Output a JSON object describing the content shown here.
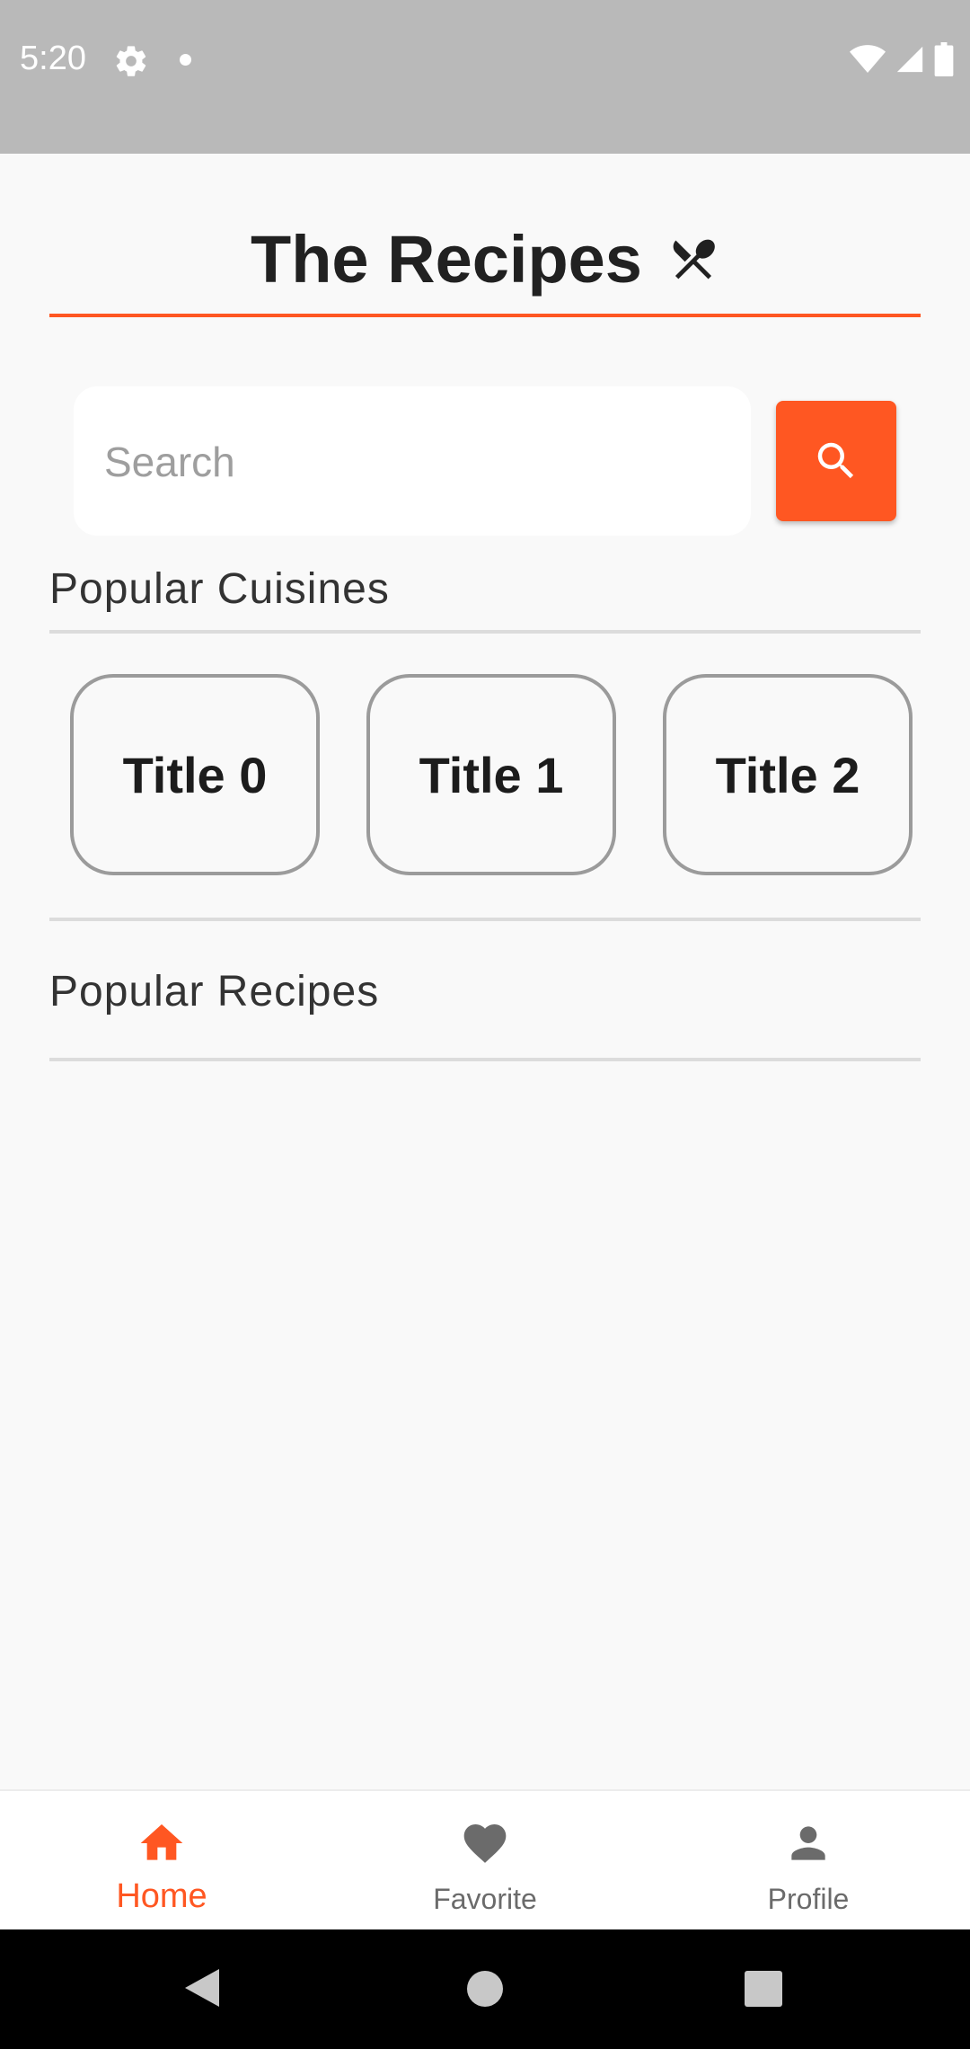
{
  "status_bar": {
    "time": "5:20"
  },
  "header": {
    "title": "The Recipes"
  },
  "search": {
    "placeholder": "Search",
    "value": ""
  },
  "popular_cuisines": {
    "heading": "Popular Cuisines",
    "cards": [
      "Title 0",
      "Title 1",
      "Title 2"
    ]
  },
  "popular_recipes": {
    "heading": "Popular Recipes"
  },
  "bottom_nav": {
    "items": [
      {
        "label": "Home",
        "icon": "home-icon",
        "active": true
      },
      {
        "label": "Favorite",
        "icon": "heart-icon",
        "active": false
      },
      {
        "label": "Profile",
        "icon": "person-icon",
        "active": false
      }
    ]
  },
  "colors": {
    "accent": "#ff5722",
    "status_bar": "#b9b9b9",
    "background": "#f9f9f9"
  }
}
